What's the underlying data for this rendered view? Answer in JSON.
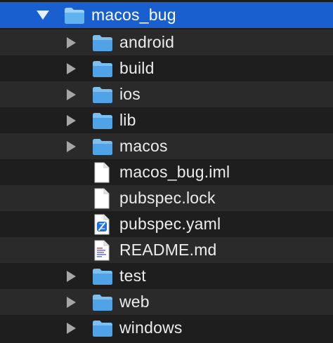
{
  "window": {
    "title": "macos_bug"
  },
  "root": {
    "label": "macos_bug",
    "icon": "folder-icon",
    "expanded": true
  },
  "items": [
    {
      "label": "android",
      "kind": "folder",
      "icon": "folder-icon"
    },
    {
      "label": "build",
      "kind": "folder",
      "icon": "folder-icon"
    },
    {
      "label": "ios",
      "kind": "folder",
      "icon": "folder-icon"
    },
    {
      "label": "lib",
      "kind": "folder",
      "icon": "folder-icon"
    },
    {
      "label": "macos",
      "kind": "folder",
      "icon": "folder-icon"
    },
    {
      "label": "macos_bug.iml",
      "kind": "file",
      "icon": "blank-document-icon"
    },
    {
      "label": "pubspec.lock",
      "kind": "file",
      "icon": "blank-document-icon"
    },
    {
      "label": "pubspec.yaml",
      "kind": "file",
      "icon": "xcode-document-icon"
    },
    {
      "label": "README.md",
      "kind": "file",
      "icon": "text-document-icon"
    },
    {
      "label": "test",
      "kind": "folder",
      "icon": "folder-icon"
    },
    {
      "label": "web",
      "kind": "folder",
      "icon": "folder-icon"
    },
    {
      "label": "windows",
      "kind": "folder",
      "icon": "folder-icon"
    }
  ],
  "colors": {
    "selection": "#1a5fcf",
    "folder": "#4fa3e6",
    "background": "#1e1e1e",
    "alt_row": "#2a2a2a",
    "text": "#ececec"
  }
}
